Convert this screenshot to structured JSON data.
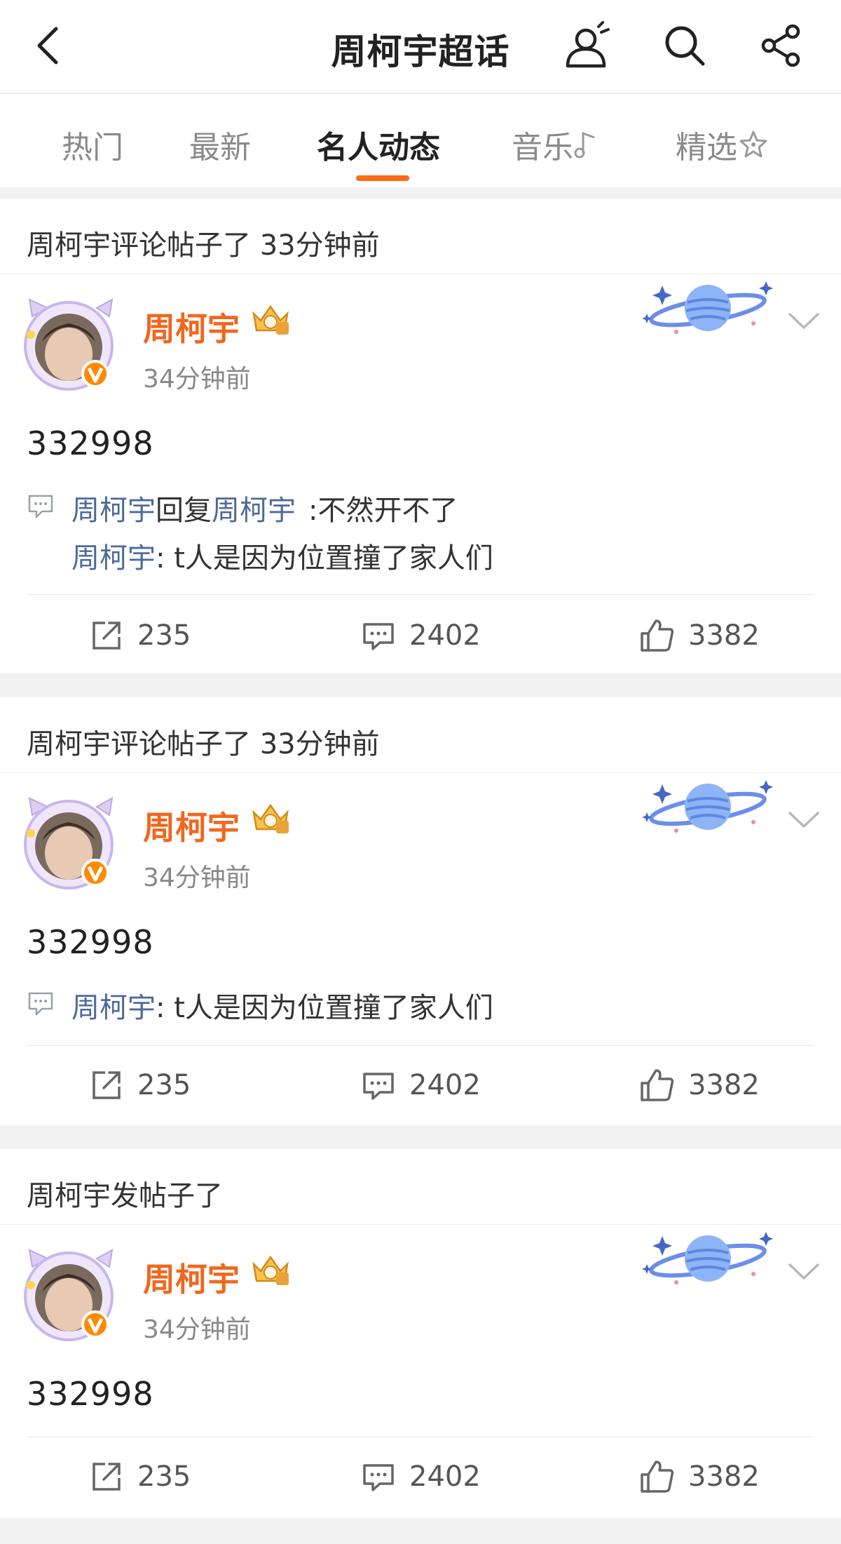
{
  "header": {
    "title": "周柯宇超话",
    "icons": [
      "back-icon",
      "avatar-sparkle-icon",
      "search-icon",
      "share-icon"
    ]
  },
  "tabs": [
    {
      "label": "热门",
      "active": false
    },
    {
      "label": "最新",
      "active": false
    },
    {
      "label": "名人动态",
      "active": true
    },
    {
      "label": "音乐",
      "active": false,
      "icon": "music-note-icon"
    },
    {
      "label": "精选",
      "active": false,
      "icon": "sparkle-star-icon"
    }
  ],
  "posts": [
    {
      "activity": "周柯宇评论帖子了 33分钟前",
      "author": "周柯宇",
      "time": "34分钟前",
      "content": "332998",
      "comments": [
        {
          "user": "周柯宇",
          "reply_word": "回复",
          "reply_to": "周柯宇",
          "text": ":不然开不了"
        },
        {
          "user": "周柯宇",
          "text": ": t人是因为位置撞了家人们"
        }
      ],
      "reposts": "235",
      "comment_count": "2402",
      "likes": "3382"
    },
    {
      "activity": "周柯宇评论帖子了 33分钟前",
      "author": "周柯宇",
      "time": "34分钟前",
      "content": "332998",
      "comments": [
        {
          "user": "周柯宇",
          "text": ": t人是因为位置撞了家人们"
        }
      ],
      "reposts": "235",
      "comment_count": "2402",
      "likes": "3382"
    },
    {
      "activity": "周柯宇发帖子了",
      "author": "周柯宇",
      "time": "34分钟前",
      "content": "332998",
      "comments": [],
      "reposts": "235",
      "comment_count": "2402",
      "likes": "3382"
    }
  ],
  "colors": {
    "author": "#f0671e",
    "tab_indicator": "#ff6a14",
    "comment_user": "#4e6a9a",
    "background": "#f2f2f2"
  }
}
